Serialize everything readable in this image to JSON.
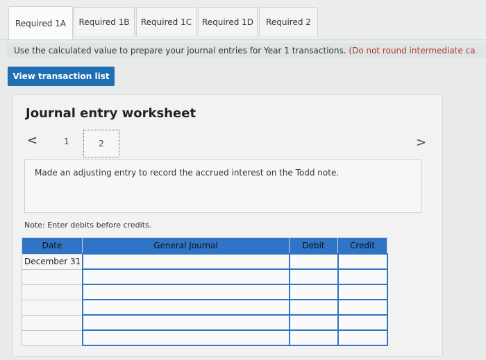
{
  "tabs": [
    {
      "label": "Required 1A",
      "active": false
    },
    {
      "label": "Required 1B",
      "active": true
    },
    {
      "label": "Required 1C",
      "active": false
    },
    {
      "label": "Required 1D",
      "active": false
    },
    {
      "label": "Required 2",
      "active": false
    }
  ],
  "instructions": {
    "text": "Use the calculated value to prepare your journal entries for Year 1 transactions.",
    "note": "(Do not round intermediate ca"
  },
  "view_button": {
    "label": "View transaction list"
  },
  "worksheet": {
    "title": "Journal entry worksheet",
    "prev_icon": "<",
    "next_icon": ">",
    "steps": [
      "1",
      "2"
    ],
    "current_step": "2",
    "description": "Made an adjusting entry to record the accrued interest on the Todd note.",
    "note": "Note: Enter debits before credits."
  },
  "journal": {
    "headers": {
      "date": "Date",
      "general_journal": "General Journal",
      "debit": "Debit",
      "credit": "Credit"
    },
    "rows": [
      {
        "date": "December 31",
        "account": "",
        "debit": "",
        "credit": ""
      },
      {
        "date": "",
        "account": "",
        "debit": "",
        "credit": ""
      },
      {
        "date": "",
        "account": "",
        "debit": "",
        "credit": ""
      },
      {
        "date": "",
        "account": "",
        "debit": "",
        "credit": ""
      },
      {
        "date": "",
        "account": "",
        "debit": "",
        "credit": ""
      },
      {
        "date": "",
        "account": "",
        "debit": "",
        "credit": ""
      }
    ]
  },
  "colors": {
    "accent": "#1e6fb3",
    "header": "#2f74c6",
    "warning": "#b0392e"
  }
}
